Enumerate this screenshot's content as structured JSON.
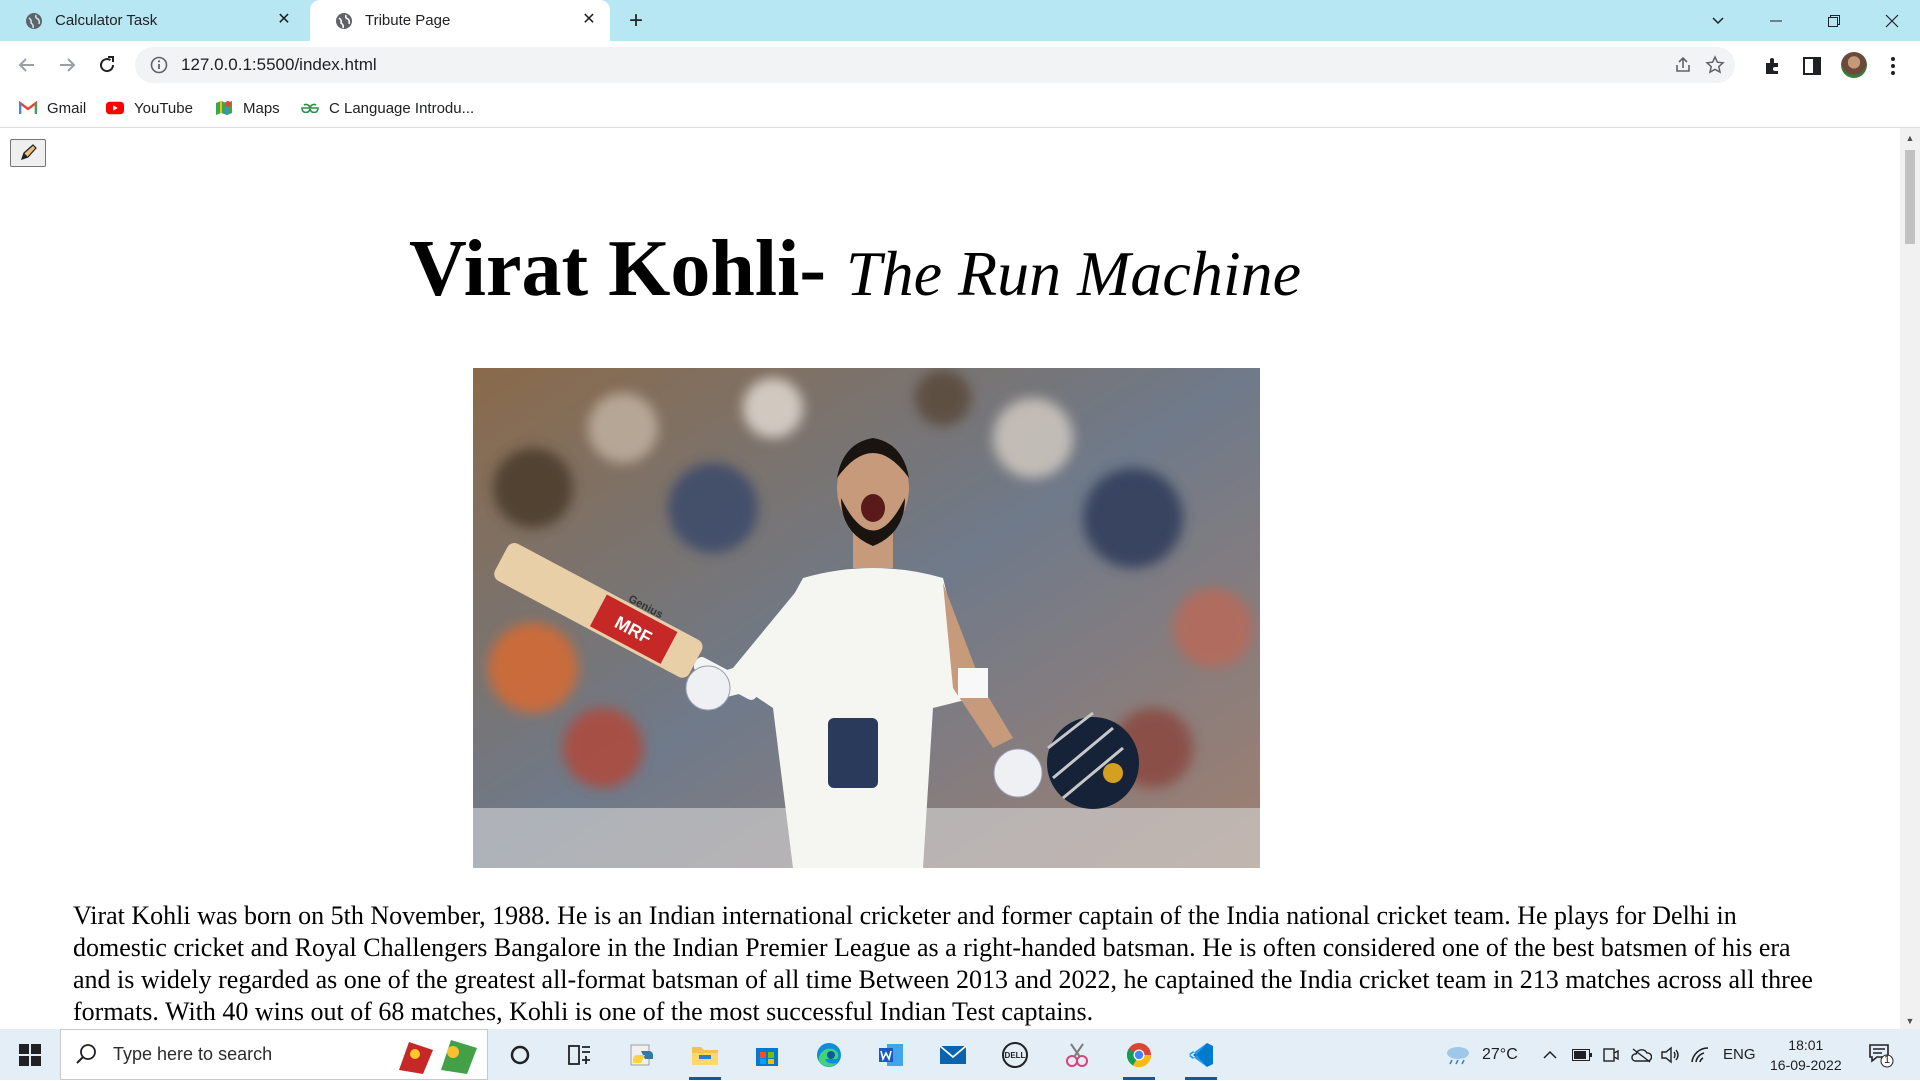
{
  "browser": {
    "tabs": [
      {
        "title": "Calculator Task"
      },
      {
        "title": "Tribute Page"
      }
    ],
    "address": "127.0.0.1:5500/index.html",
    "bookmarks": [
      {
        "label": "Gmail"
      },
      {
        "label": "YouTube"
      },
      {
        "label": "Maps"
      },
      {
        "label": "C Language Introdu..."
      }
    ]
  },
  "page": {
    "title_main": "Virat Kohli-",
    "title_sub": "The Run Machine",
    "bat_brand": "MRF",
    "bat_sub": "Genius",
    "bio": "Virat Kohli was born on 5th November, 1988. He is an Indian international cricketer and former captain of the India national cricket team. He plays for Delhi in domestic cricket and Royal Challengers Bangalore in the Indian Premier League as a right-handed batsman. He is often considered one of the best batsmen of his era and is widely regarded as one of the greatest all-format batsman of all time Between 2013 and 2022, he captained the India cricket team in 213 matches across all three formats. With 40 wins out of 68 matches, Kohli is one of the most successful Indian Test captains."
  },
  "taskbar": {
    "search_placeholder": "Type here to search",
    "weather": "27°C",
    "language": "ENG",
    "time": "18:01",
    "date": "16-09-2022",
    "notifications": "1"
  }
}
